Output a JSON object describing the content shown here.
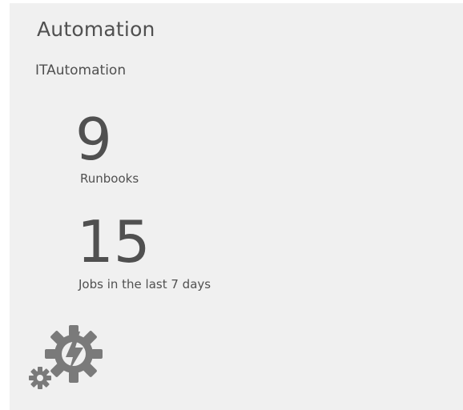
{
  "tile": {
    "title": "Automation",
    "account": "ITAutomation",
    "metrics": [
      {
        "value": "9",
        "label": "Runbooks"
      },
      {
        "value": "15",
        "label": "Jobs in the last 7 days"
      }
    ],
    "icon": "automation-gears-lightning-icon",
    "colors": {
      "background": "#f0f0f0",
      "text": "#505050",
      "icon": "#7a7a7a"
    }
  }
}
